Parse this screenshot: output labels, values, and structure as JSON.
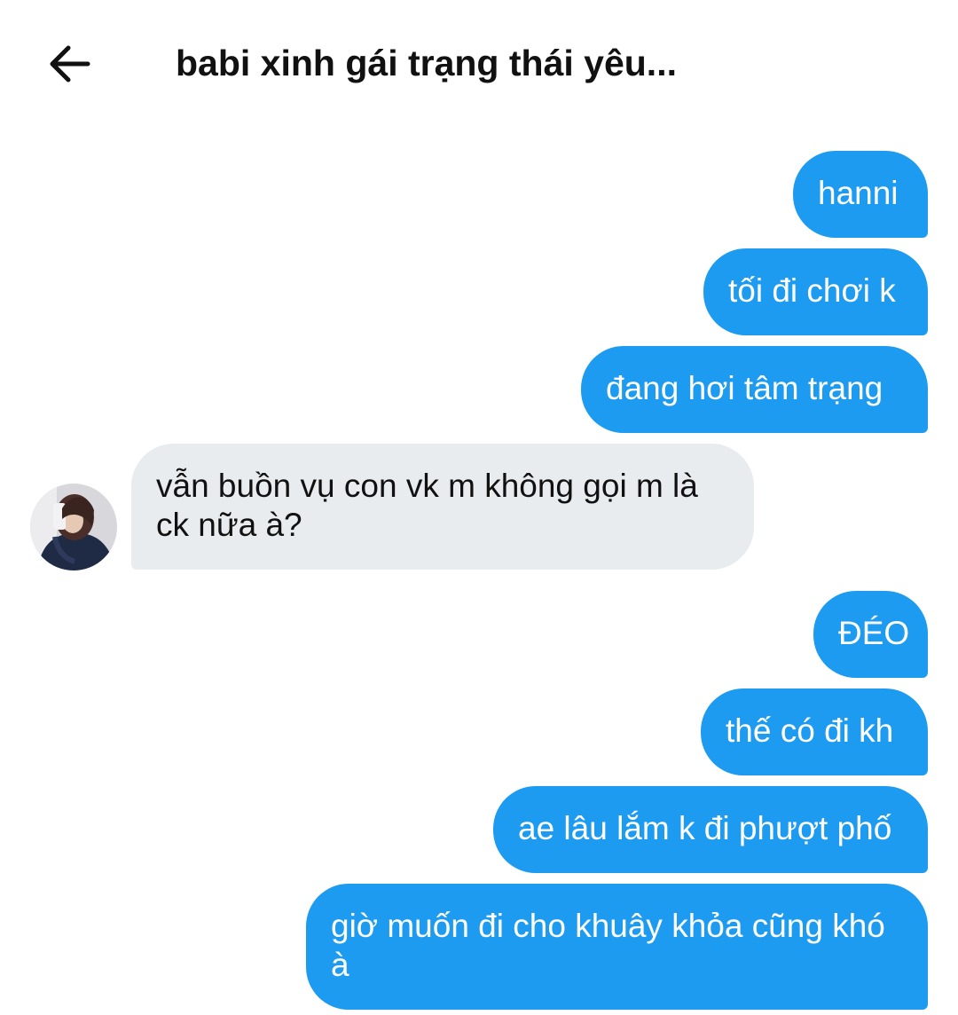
{
  "header": {
    "title": "babi xinh gái trạng thái yêu..."
  },
  "messages": [
    {
      "side": "sent",
      "text": "hanni"
    },
    {
      "side": "sent",
      "text": "tối đi chơi k"
    },
    {
      "side": "sent",
      "text": "đang hơi tâm trạng"
    },
    {
      "side": "received",
      "line1": "vẫn buồn vụ con vk m không gọi m là",
      "line2": "ck nữa à?"
    },
    {
      "side": "sent",
      "text": "ĐÉO"
    },
    {
      "side": "sent",
      "text": "thế có đi kh"
    },
    {
      "side": "sent",
      "text": "ae lâu lắm k đi phượt phố"
    },
    {
      "side": "sent",
      "line1": "giờ muốn đi cho khuây khỏa cũng khó",
      "line2": "à"
    }
  ],
  "colors": {
    "sent_bubble": "#1d9bf0",
    "received_bubble": "#e8ecef"
  }
}
